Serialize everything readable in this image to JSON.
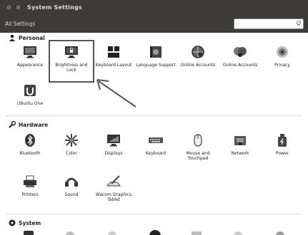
{
  "window": {
    "title": "System Settings"
  },
  "toolbar": {
    "all_settings_label": "All Settings",
    "search_placeholder": "",
    "search_icon": "Q"
  },
  "sections": {
    "personal": {
      "title": "Personal",
      "items": [
        {
          "label": "Appearance",
          "icon": "appearance-icon"
        },
        {
          "label": "Brightness and Lock",
          "icon": "brightness-lock-icon"
        },
        {
          "label": "Keyboard Layout",
          "icon": "keyboard-layout-icon"
        },
        {
          "label": "Language Support",
          "icon": "language-support-icon"
        },
        {
          "label": "Online Accounts",
          "icon": "online-accounts-icon"
        },
        {
          "label": "Online Accounts",
          "icon": "online-accounts-icon-2"
        },
        {
          "label": "Privacy",
          "icon": "privacy-icon"
        },
        {
          "label": "Ubuntu One",
          "icon": "ubuntu-one-icon"
        }
      ]
    },
    "hardware": {
      "title": "Hardware",
      "items": [
        {
          "label": "Bluetooth",
          "icon": "bluetooth-icon"
        },
        {
          "label": "Color",
          "icon": "color-icon"
        },
        {
          "label": "Displays",
          "icon": "displays-icon"
        },
        {
          "label": "Keyboard",
          "icon": "keyboard-icon"
        },
        {
          "label": "Mouse and Touchpad",
          "icon": "mouse-icon"
        },
        {
          "label": "Network",
          "icon": "network-icon"
        },
        {
          "label": "Power",
          "icon": "power-icon"
        },
        {
          "label": "Printers",
          "icon": "printer-icon"
        },
        {
          "label": "Sound",
          "icon": "sound-icon"
        },
        {
          "label": "Wacom Graphics Tablet",
          "icon": "wacom-icon"
        }
      ]
    },
    "system": {
      "title": "System"
    }
  },
  "colors": {
    "titlebar": "#3c3b37",
    "annotation": "#555555"
  }
}
